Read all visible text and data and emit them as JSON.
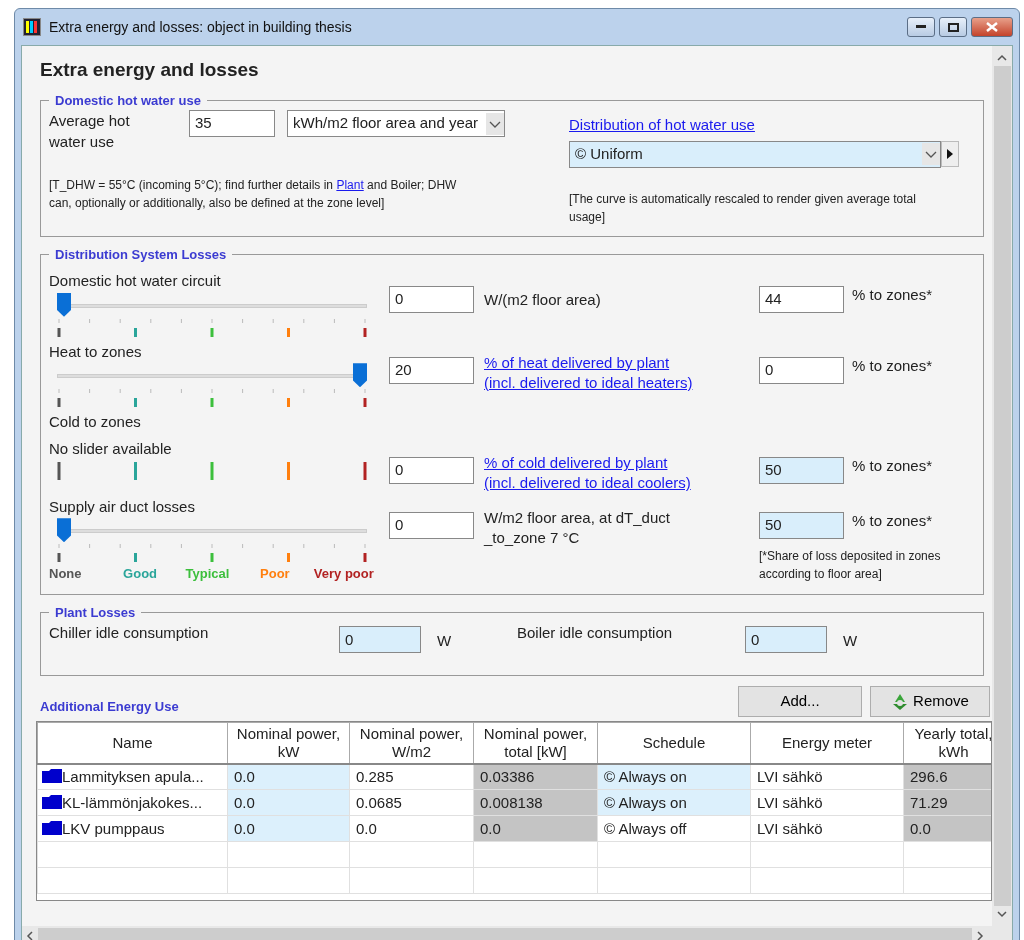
{
  "window": {
    "title": "Extra energy and losses: object in building thesis"
  },
  "heading": "Extra energy and losses",
  "dhw": {
    "legend": "Domestic hot water use",
    "label": "Average hot water use",
    "value": "35",
    "unit": "kWh/m2 floor area and year",
    "distribution_link": "Distribution of hot water use",
    "distribution": "© Uniform",
    "note_before": "[T_DHW = 55°C (incoming 5°C); find further details in ",
    "note_link": "Plant",
    "note_after": " and Boiler; DHW can, optionally or additionally, also be defined at the zone level]",
    "note_right": "[The curve is automatically rescaled to render given average total usage]"
  },
  "distribution": {
    "legend": "Distribution System Losses",
    "rows": [
      {
        "kind": "slider",
        "label": "Domestic hot water circuit",
        "level": 0,
        "value": "0",
        "unit_lines": [
          "W/(m2 floor area)"
        ],
        "unit_is_link": false,
        "share": "44",
        "share_highlighted": false,
        "share_suffix": "% to zones*"
      },
      {
        "kind": "slider",
        "label": "Heat to zones",
        "level": 1,
        "value": "20",
        "unit_lines": [
          "% of heat delivered by plant",
          "(incl. delivered to ideal heaters)"
        ],
        "unit_is_link": true,
        "share": "0",
        "share_highlighted": false,
        "share_suffix": "% to zones*"
      },
      {
        "kind": "no_slider",
        "label": "Cold to zones",
        "slider_note": "No slider available",
        "value": "0",
        "unit_lines": [
          "% of cold delivered by plant",
          "(incl. delivered to ideal coolers)"
        ],
        "unit_is_link": true,
        "share": "50",
        "share_highlighted": true,
        "share_suffix": "% to zones*"
      },
      {
        "kind": "slider",
        "label": "Supply air duct losses",
        "level": 0,
        "value": "0",
        "unit_lines": [
          "W/m2 floor area, at dT_duct",
          "_to_zone 7 °C"
        ],
        "unit_is_link": false,
        "share": "50",
        "share_highlighted": true,
        "share_suffix": "% to zones*"
      }
    ],
    "scale": [
      {
        "label": "None",
        "color": "#555555"
      },
      {
        "label": "Good",
        "color": "#2aa59a"
      },
      {
        "label": "Typical",
        "color": "#3cbf3c"
      },
      {
        "label": "Poor",
        "color": "#ff7f0e"
      },
      {
        "label": "Very poor",
        "color": "#b22222"
      }
    ],
    "footnote": "[*Share of loss deposited in zones according to floor area]"
  },
  "plant": {
    "legend": "Plant Losses",
    "items": [
      {
        "label": "Chiller idle consumption",
        "value": "0",
        "unit": "W",
        "highlighted": true
      },
      {
        "label": "Boiler idle consumption",
        "value": "0",
        "unit": "W",
        "highlighted": true
      }
    ]
  },
  "additional": {
    "title": "Additional Energy Use",
    "buttons": [
      {
        "label": "Add...",
        "kind": "plain"
      },
      {
        "label": "Remove",
        "kind": "recycle"
      }
    ],
    "columns": [
      "Name",
      "Nominal power, kW",
      "Nominal power, W/m2",
      "Nominal power, total [kW]",
      "Schedule",
      "Energy meter",
      "Yearly total, kWh"
    ],
    "rows": [
      [
        {
          "text": "Lammityksen apula...",
          "kind": "name"
        },
        {
          "text": "0.0",
          "kind": "editable"
        },
        {
          "text": "0.285",
          "kind": "plain"
        },
        {
          "text": "0.03386",
          "kind": "computed"
        },
        {
          "text": "© Always on",
          "kind": "editable"
        },
        {
          "text": "LVI sähkö",
          "kind": "plain"
        },
        {
          "text": "296.6",
          "kind": "computed"
        }
      ],
      [
        {
          "text": "KL-lämmönjakokes...",
          "kind": "name"
        },
        {
          "text": "0.0",
          "kind": "editable"
        },
        {
          "text": "0.0685",
          "kind": "plain"
        },
        {
          "text": "0.008138",
          "kind": "computed"
        },
        {
          "text": "© Always on",
          "kind": "editable"
        },
        {
          "text": "LVI sähkö",
          "kind": "plain"
        },
        {
          "text": "71.29",
          "kind": "computed"
        }
      ],
      [
        {
          "text": "LKV pumppaus",
          "kind": "name"
        },
        {
          "text": "0.0",
          "kind": "editable"
        },
        {
          "text": "0.0",
          "kind": "plain"
        },
        {
          "text": "0.0",
          "kind": "computed"
        },
        {
          "text": "© Always off",
          "kind": "plain"
        },
        {
          "text": "LVI sähkö",
          "kind": "plain"
        },
        {
          "text": "0.0",
          "kind": "computed"
        }
      ]
    ]
  }
}
